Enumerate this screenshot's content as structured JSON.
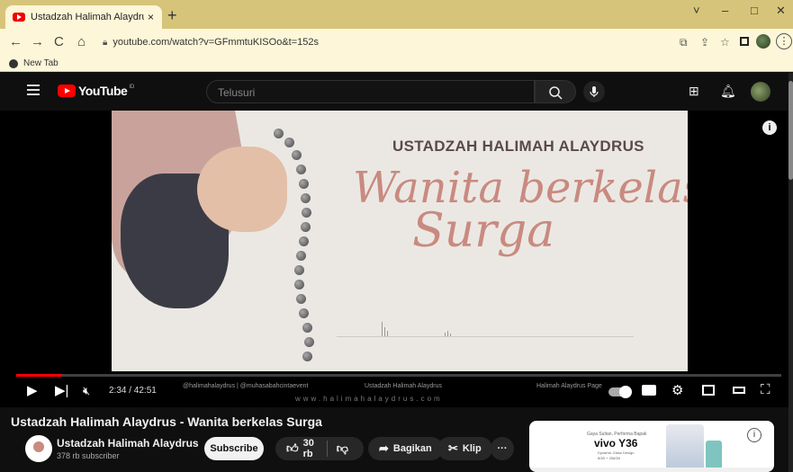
{
  "browser": {
    "tab_title": "Ustadzah Halimah Alaydrus - Wa",
    "tab_close": "×",
    "new_tab": "+",
    "url": "youtube.com/watch?v=GFmmtuKISOo&t=152s",
    "bookmark": "New Tab",
    "window_controls": [
      "˅",
      "–",
      "□",
      "✕"
    ]
  },
  "youtube": {
    "logo_text": "YouTube",
    "logo_sup": "ID",
    "search_placeholder": "Telusuri"
  },
  "video": {
    "overlay_heading": "USTADZAH HALIMAH ALAYDRUS",
    "overlay_script_line1": "Wanita berkelas",
    "overlay_script_line2": "Surga",
    "time": "2:34 / 42:51",
    "progress": 0.06,
    "credits_1": "@halimahalaydrus | @muhasabahcintaevent",
    "credits_2": "Ustadzah Halimah Alaydrus",
    "credits_3": "Halimah Alaydrus Page",
    "credits_url": "www.halimahalaydrus.com",
    "info_icon": "i"
  },
  "details": {
    "title": "Ustadzah Halimah Alaydrus - Wanita berkelas Surga",
    "channel_name": "Ustadzah Halimah Alaydrus",
    "verified": "✔",
    "subscribers": "378 rb subscriber",
    "subscribe_label": "Subscribe",
    "like_count": "30 rb",
    "share_label": "Bagikan",
    "clip_label": "Klip",
    "more_label": "···"
  },
  "ad": {
    "tagline": "Gaya Sultan, Performa Bapak",
    "brand": "vivo Y36",
    "line1": "Dynamic Glass Design",
    "line2": "8GB + 256GB",
    "info_icon": "i"
  },
  "colors": {
    "accent": "#ff0000",
    "chrome_frame": "#d6c47a",
    "toolbar": "#fdf6d8",
    "script_text": "#c98a80"
  }
}
